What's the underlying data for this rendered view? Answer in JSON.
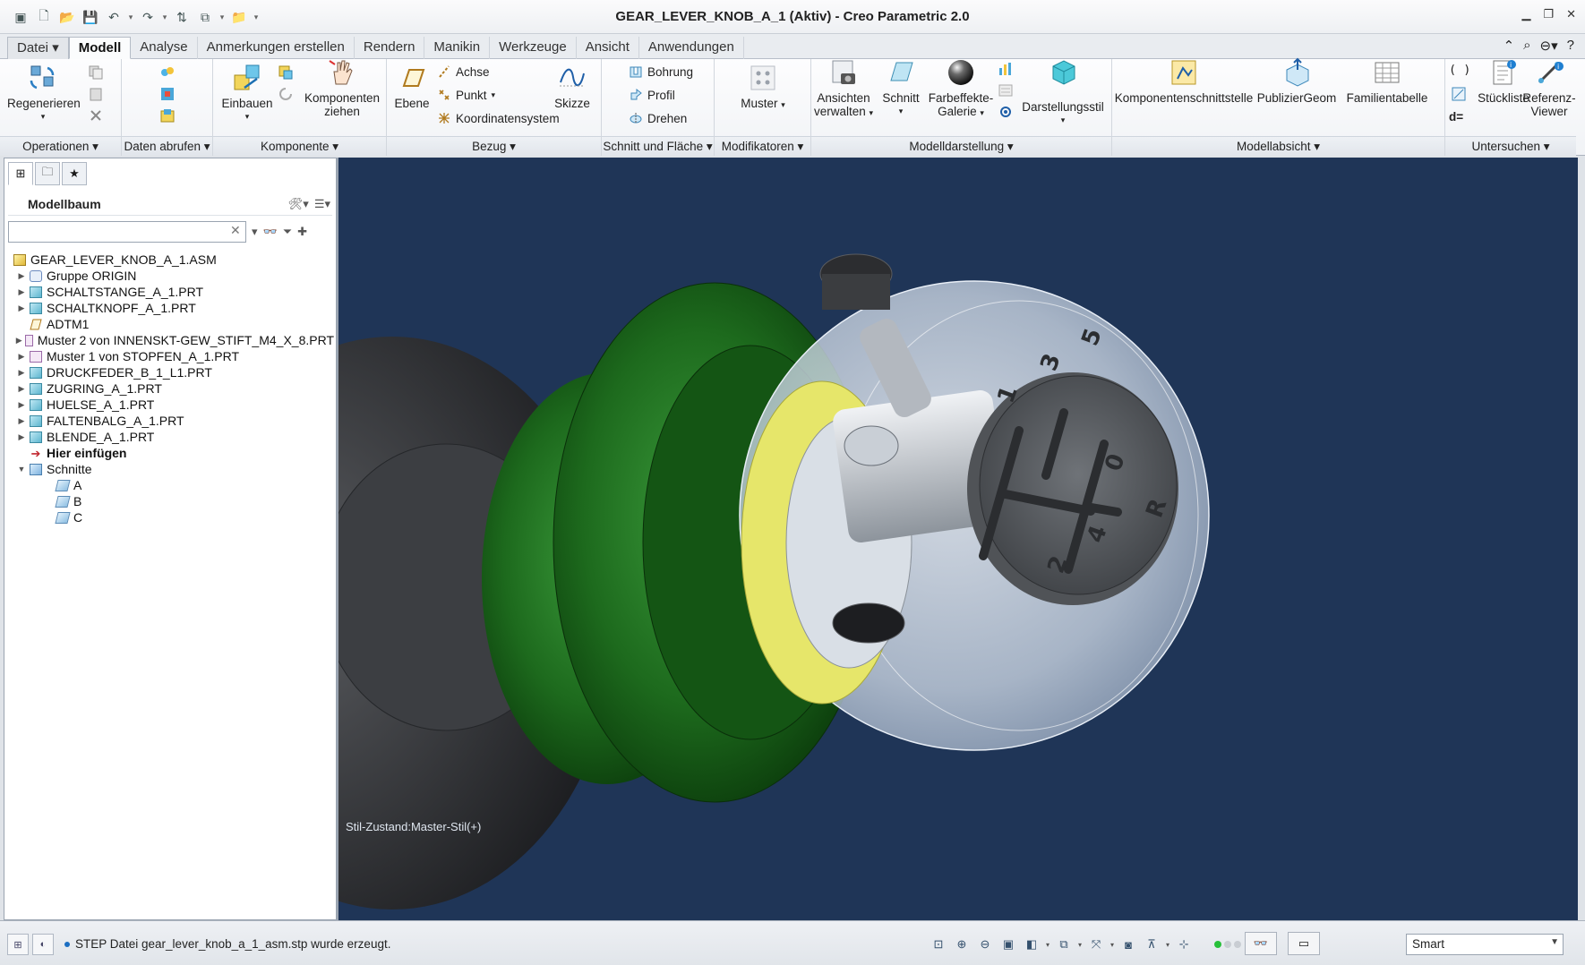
{
  "window": {
    "title": "GEAR_LEVER_KNOB_A_1 (Aktiv) - Creo Parametric 2.0",
    "controls": [
      "▁",
      "❐",
      "✕"
    ]
  },
  "tabs": [
    "Datei",
    "Modell",
    "Analyse",
    "Anmerkungen erstellen",
    "Rendern",
    "Manikin",
    "Werkzeuge",
    "Ansicht",
    "Anwendungen"
  ],
  "ribbon": {
    "groups": {
      "operationen": "Operationen",
      "daten": "Daten abrufen",
      "komponente": "Komponente",
      "bezug": "Bezug",
      "schnitt": "Schnitt und Fläche",
      "modifikatoren": "Modifikatoren",
      "modelldarstellung": "Modelldarstellung",
      "modellabsicht": "Modellabsicht",
      "untersuchen": "Untersuchen"
    },
    "regenerieren": "Regenerieren",
    "einbauen": "Einbauen",
    "komponenten_ziehen_1": "Komponenten",
    "komponenten_ziehen_2": "ziehen",
    "ebene": "Ebene",
    "achse": "Achse",
    "punkt": "Punkt",
    "koordinatensystem": "Koordinatensystem",
    "skizze": "Skizze",
    "bohrung": "Bohrung",
    "profil": "Profil",
    "drehen": "Drehen",
    "muster": "Muster",
    "ansichten_1": "Ansichten",
    "ansichten_2": "verwalten",
    "schnitt": "Schnitt",
    "farbeffekte_1": "Farbeffekte-",
    "farbeffekte_2": "Galerie",
    "darstellungsstil": "Darstellungsstil",
    "komponentenschnittstelle": "Komponentenschnittstelle",
    "publiziergeom": "PublizierGeom",
    "familientabelle": "Familientabelle",
    "stueckliste": "Stückliste",
    "referenz_1": "Referenz-",
    "referenz_2": "Viewer",
    "d_equals": "d="
  },
  "model_tree": {
    "title": "Modellbaum",
    "search_placeholder": "",
    "items": [
      {
        "label": "GEAR_LEVER_KNOB_A_1.ASM",
        "icon": "assembly-icon",
        "level": 0,
        "arrow": ""
      },
      {
        "label": "Gruppe ORIGIN",
        "icon": "group-icon",
        "level": 1,
        "arrow": "▶"
      },
      {
        "label": "SCHALTSTANGE_A_1.PRT",
        "icon": "part-icon",
        "level": 1,
        "arrow": "▶"
      },
      {
        "label": "SCHALTKNOPF_A_1.PRT",
        "icon": "part-icon",
        "level": 1,
        "arrow": "▶"
      },
      {
        "label": "ADTM1",
        "icon": "datum-plane-icon",
        "level": 1,
        "arrow": ""
      },
      {
        "label": "Muster 2 von INNENSKT-GEW_STIFT_M4_X_8.PRT",
        "icon": "pattern-icon",
        "level": 1,
        "arrow": "▶"
      },
      {
        "label": "Muster 1 von STOPFEN_A_1.PRT",
        "icon": "pattern-icon",
        "level": 1,
        "arrow": "▶"
      },
      {
        "label": "DRUCKFEDER_B_1_L1.PRT",
        "icon": "part-icon",
        "level": 1,
        "arrow": "▶"
      },
      {
        "label": "ZUGRING_A_1.PRT",
        "icon": "part-icon",
        "level": 1,
        "arrow": "▶"
      },
      {
        "label": "HUELSE_A_1.PRT",
        "icon": "part-icon",
        "level": 1,
        "arrow": "▶"
      },
      {
        "label": "FALTENBALG_A_1.PRT",
        "icon": "part-icon",
        "level": 1,
        "arrow": "▶"
      },
      {
        "label": "BLENDE_A_1.PRT",
        "icon": "part-icon",
        "level": 1,
        "arrow": "▶"
      },
      {
        "label": "Hier einfügen",
        "icon": "insert-here-icon",
        "level": 1,
        "arrow": ""
      },
      {
        "label": "Schnitte",
        "icon": "folder-icon",
        "level": 1,
        "arrow": "▼"
      },
      {
        "label": "A",
        "icon": "section-icon",
        "level": 2,
        "arrow": ""
      },
      {
        "label": "B",
        "icon": "section-icon",
        "level": 2,
        "arrow": ""
      },
      {
        "label": "C",
        "icon": "section-icon",
        "level": 2,
        "arrow": ""
      }
    ]
  },
  "viewport": {
    "style_state": "Stil-Zustand:Master-Stil(+)",
    "background_color": "#1f3557",
    "shift_digits": [
      "1",
      "3",
      "5",
      "2",
      "4",
      "R",
      "0"
    ]
  },
  "status": {
    "message": "STEP Datei gear_lever_knob_a_1_asm.stp wurde erzeugt.",
    "filter_value": "Smart"
  }
}
